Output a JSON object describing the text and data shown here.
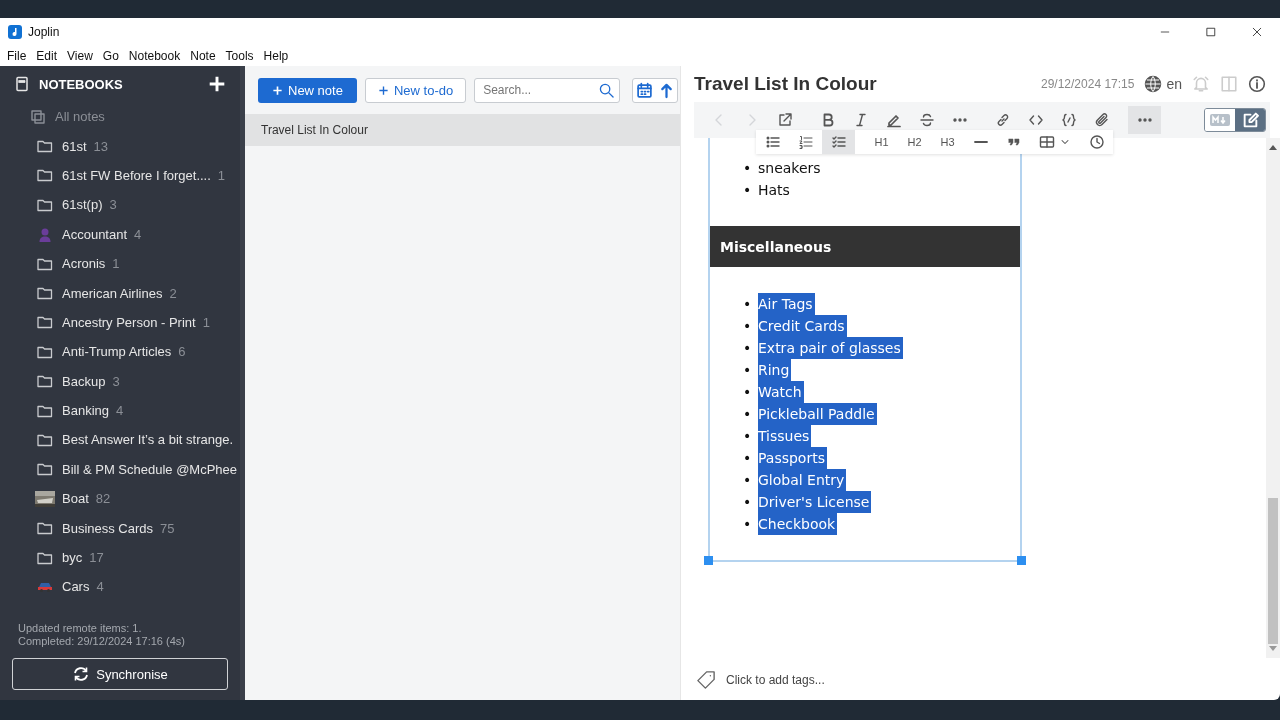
{
  "window": {
    "title": "Joplin"
  },
  "menu": [
    "File",
    "Edit",
    "View",
    "Go",
    "Notebook",
    "Note",
    "Tools",
    "Help"
  ],
  "sidebar": {
    "header": "NOTEBOOKS",
    "all_notes": "All notes",
    "notebooks": [
      {
        "name": "61st",
        "count": "13",
        "kind": "folder"
      },
      {
        "name": "61st FW Before I forget....",
        "count": "1",
        "kind": "folder"
      },
      {
        "name": "61st(p)",
        "count": "3",
        "kind": "folder"
      },
      {
        "name": "Accountant",
        "count": "4",
        "kind": "person"
      },
      {
        "name": "Acronis",
        "count": "1",
        "kind": "folder"
      },
      {
        "name": "American Airlines",
        "count": "2",
        "kind": "folder"
      },
      {
        "name": "Ancestry Person - Print",
        "count": "1",
        "kind": "folder"
      },
      {
        "name": "Anti-Trump Articles",
        "count": "6",
        "kind": "folder"
      },
      {
        "name": "Backup",
        "count": "3",
        "kind": "folder"
      },
      {
        "name": "Banking",
        "count": "4",
        "kind": "folder"
      },
      {
        "name": "Best Answer It’s a bit strange.",
        "kind": "folder"
      },
      {
        "name": "Bill & PM Schedule @McPhee",
        "kind": "folder"
      },
      {
        "name": "Boat",
        "count": "82",
        "kind": "picture"
      },
      {
        "name": "Business Cards",
        "count": "75",
        "kind": "folder"
      },
      {
        "name": "byc",
        "count": "17",
        "kind": "folder"
      },
      {
        "name": "Cars",
        "count": "4",
        "kind": "car"
      }
    ],
    "sync_status": [
      "Updated remote items: 1.",
      "Completed: 29/12/2024 17:16 (4s)"
    ],
    "sync_button": "Synchronise"
  },
  "note_list": {
    "new_note": "New note",
    "new_todo": "New to-do",
    "search": {
      "placeholder": "Search..."
    },
    "notes": [
      {
        "title": "Travel List In Colour",
        "selected": true
      }
    ]
  },
  "editor": {
    "title": "Travel List In Colour",
    "date": "29/12/2024 17:15",
    "language": "en",
    "toolbar": [
      {
        "kind": "back",
        "disabled": true,
        "active": false
      },
      {
        "kind": "forward",
        "disabled": true,
        "active": false
      },
      {
        "kind": "external",
        "disabled": false,
        "active": false
      },
      {
        "kind": "bold",
        "disabled": false,
        "active": false
      },
      {
        "kind": "italic",
        "disabled": false,
        "active": false
      },
      {
        "kind": "highlight",
        "disabled": false,
        "active": false
      },
      {
        "kind": "strike",
        "disabled": false,
        "active": false
      },
      {
        "kind": "more",
        "disabled": false,
        "active": false
      },
      {
        "kind": "link",
        "disabled": false,
        "active": false
      },
      {
        "kind": "code",
        "disabled": false,
        "active": false
      },
      {
        "kind": "codeblock",
        "disabled": false,
        "active": false
      },
      {
        "kind": "attach",
        "disabled": false,
        "active": false
      },
      {
        "kind": "more",
        "disabled": false,
        "active": true
      }
    ],
    "toolbar_row2": [
      {
        "kind": "bullets",
        "active": false
      },
      {
        "kind": "numbers",
        "active": false
      },
      {
        "kind": "checklist",
        "active": true
      },
      {
        "kind": "heading",
        "label": "H1",
        "active": false
      },
      {
        "kind": "heading",
        "label": "H2",
        "active": false
      },
      {
        "kind": "heading",
        "label": "H3",
        "active": false
      },
      {
        "kind": "rule",
        "active": false
      },
      {
        "kind": "quote",
        "active": false
      },
      {
        "kind": "table",
        "active": false
      },
      {
        "kind": "time",
        "active": false
      }
    ],
    "content": {
      "marker": "•",
      "list_top": [
        "sneakers",
        "Hats"
      ],
      "heading": "Miscellaneous",
      "list": {
        "selected": true,
        "items": [
          "Air Tags",
          "Credit Cards",
          "Extra pair of glasses",
          "Ring",
          "Watch",
          "Pickleball Paddle",
          "Tissues",
          "Passports",
          "Global Entry",
          "Driver's License",
          "Checkbook"
        ]
      }
    },
    "tags_placeholder": "Click to add tags..."
  }
}
